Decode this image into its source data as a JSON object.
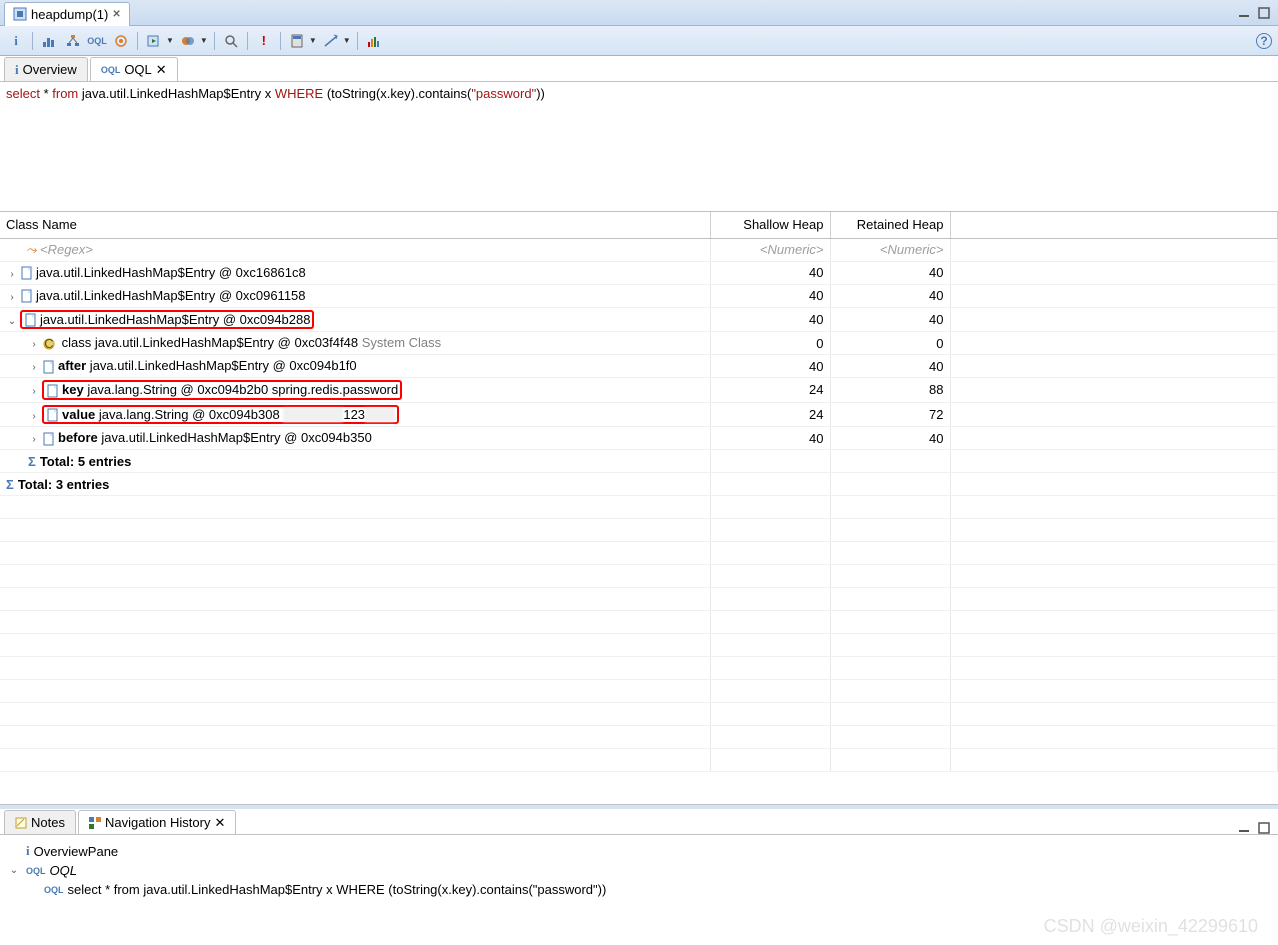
{
  "editor_tab": {
    "title": "heapdump(1)"
  },
  "sub_tabs": [
    {
      "label": "Overview",
      "active": false
    },
    {
      "label": "OQL",
      "active": true
    }
  ],
  "query": {
    "text": "select * from java.util.LinkedHashMap$Entry x WHERE (toString(x.key).contains(\"password\"))",
    "parts": [
      {
        "t": "select",
        "k": true
      },
      {
        "t": " * ",
        "k": false
      },
      {
        "t": "from",
        "k": true
      },
      {
        "t": " java.util.LinkedHashMap$Entry x ",
        "k": false
      },
      {
        "t": "WHERE",
        "k": true
      },
      {
        "t": " (toString(x.key).contains(",
        "k": false
      },
      {
        "t": "\"password\"",
        "k": true
      },
      {
        "t": "))",
        "k": false
      }
    ]
  },
  "columns": {
    "c1": "Class Name",
    "c2": "Shallow Heap",
    "c3": "Retained Heap"
  },
  "filter_row": {
    "regex": "<Regex>",
    "num": "<Numeric>"
  },
  "rows": [
    {
      "indent": 0,
      "toggle": ">",
      "icon": "class",
      "text": "java.util.LinkedHashMap$Entry @ 0xc16861c8",
      "shallow": "40",
      "retained": "40"
    },
    {
      "indent": 0,
      "toggle": ">",
      "icon": "class",
      "text": "java.util.LinkedHashMap$Entry @ 0xc0961158",
      "shallow": "40",
      "retained": "40"
    },
    {
      "indent": 0,
      "toggle": "v",
      "icon": "class",
      "text": "java.util.LinkedHashMap$Entry @ 0xc094b288",
      "shallow": "40",
      "retained": "40",
      "highlight": true
    },
    {
      "indent": 1,
      "toggle": ">",
      "icon": "cls",
      "bold": "<class>",
      "text": " class java.util.LinkedHashMap$Entry @ 0xc03f4f48 ",
      "grey": "System Class",
      "shallow": "0",
      "retained": "0"
    },
    {
      "indent": 1,
      "toggle": ">",
      "icon": "class",
      "bold": "after",
      "text": " java.util.LinkedHashMap$Entry @ 0xc094b1f0",
      "shallow": "40",
      "retained": "40"
    },
    {
      "indent": 1,
      "toggle": ">",
      "icon": "class",
      "bold": "key",
      "text": " java.lang.String @ 0xc094b2b0  spring.redis.password",
      "shallow": "24",
      "retained": "88",
      "highlight": true
    },
    {
      "indent": 1,
      "toggle": ">",
      "icon": "class",
      "bold": "value",
      "text": " java.lang.String @ 0xc094b308  ",
      "blurred": "123",
      "shallow": "24",
      "retained": "72",
      "highlight": true
    },
    {
      "indent": 1,
      "toggle": ">",
      "icon": "class",
      "bold": "before",
      "text": " java.util.LinkedHashMap$Entry @ 0xc094b350",
      "shallow": "40",
      "retained": "40"
    },
    {
      "indent": 1,
      "total": "Total: 5 entries"
    },
    {
      "indent": 0,
      "total": "Total: 3 entries"
    }
  ],
  "notes_tab": "Notes",
  "nav_tab": "Navigation History",
  "nav": {
    "overview": "OverviewPane",
    "oql_label": "OQL",
    "oql_query": "select * from java.util.LinkedHashMap$Entry x WHERE (toString(x.key).contains(\"password\"))"
  },
  "watermark": "CSDN @weixin_42299610"
}
